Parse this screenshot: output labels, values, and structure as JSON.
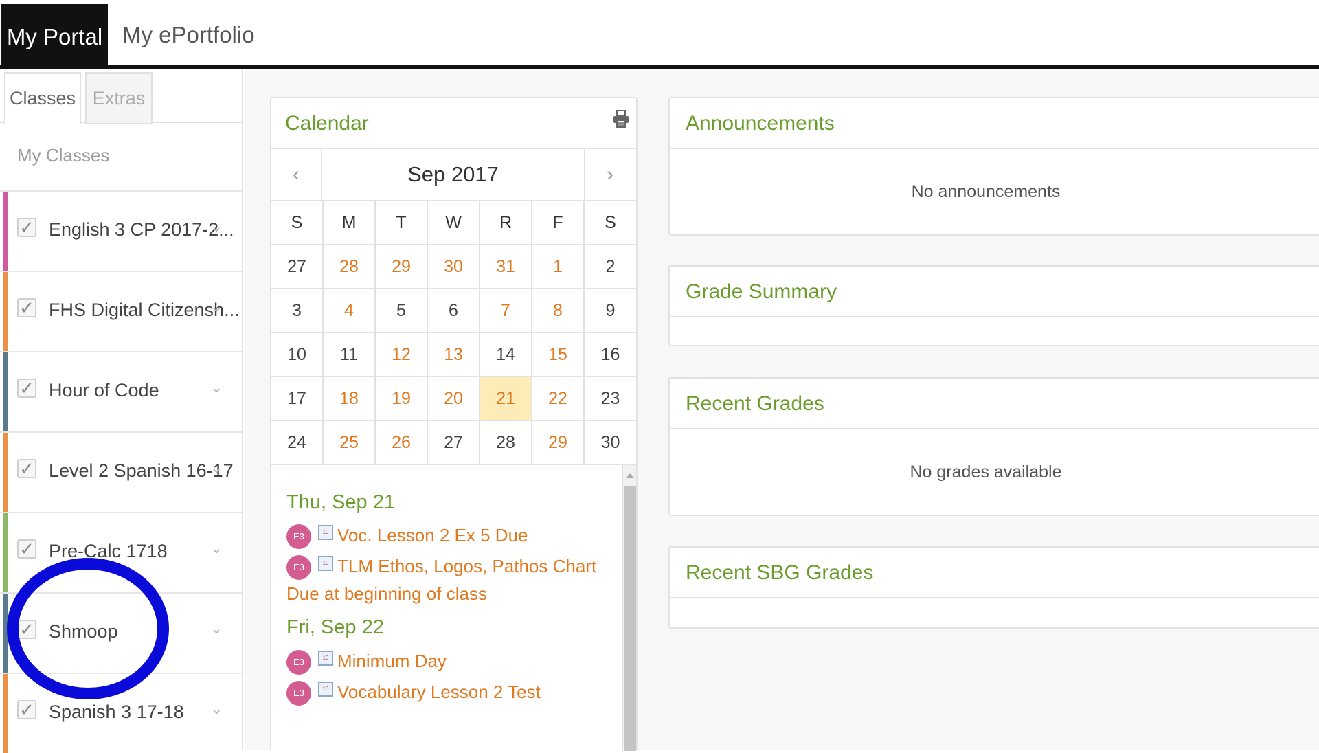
{
  "topnav": {
    "portal_tab": "My Portal",
    "eportfolio_tab": "My ePortfolio"
  },
  "sidebar": {
    "tabs": {
      "classes": "Classes",
      "extras": "Extras"
    },
    "heading": "My Classes",
    "classes": [
      {
        "name": "English 3 CP 2017-2...",
        "color": "#cf5c9c",
        "checked": true
      },
      {
        "name": "FHS Digital Citizensh...",
        "color": "#ec8f47",
        "checked": true
      },
      {
        "name": "Hour of Code",
        "color": "#5a7b8f",
        "checked": true
      },
      {
        "name": "Level 2 Spanish 16-17",
        "color": "#ec8f47",
        "checked": true
      },
      {
        "name": "Pre-Calc 1718",
        "color": "#8cb86a",
        "checked": true
      },
      {
        "name": "Shmoop",
        "color": "#5a7b8f",
        "checked": true
      },
      {
        "name": "Spanish 3 17-18",
        "color": "#ec8f47",
        "checked": true
      }
    ]
  },
  "calendar": {
    "title": "Calendar",
    "month_label": "Sep 2017",
    "prev": "‹",
    "next": "›",
    "weekdays": [
      "S",
      "M",
      "T",
      "W",
      "R",
      "F",
      "S"
    ],
    "weeks": [
      [
        {
          "d": "27",
          "ev": false
        },
        {
          "d": "28",
          "ev": true
        },
        {
          "d": "29",
          "ev": true
        },
        {
          "d": "30",
          "ev": true
        },
        {
          "d": "31",
          "ev": true
        },
        {
          "d": "1",
          "ev": true
        },
        {
          "d": "2",
          "ev": false
        }
      ],
      [
        {
          "d": "3",
          "ev": false
        },
        {
          "d": "4",
          "ev": true
        },
        {
          "d": "5",
          "ev": false
        },
        {
          "d": "6",
          "ev": false
        },
        {
          "d": "7",
          "ev": true
        },
        {
          "d": "8",
          "ev": true
        },
        {
          "d": "9",
          "ev": false
        }
      ],
      [
        {
          "d": "10",
          "ev": false
        },
        {
          "d": "11",
          "ev": false
        },
        {
          "d": "12",
          "ev": true
        },
        {
          "d": "13",
          "ev": true
        },
        {
          "d": "14",
          "ev": false
        },
        {
          "d": "15",
          "ev": true
        },
        {
          "d": "16",
          "ev": false
        }
      ],
      [
        {
          "d": "17",
          "ev": false
        },
        {
          "d": "18",
          "ev": true
        },
        {
          "d": "19",
          "ev": true
        },
        {
          "d": "20",
          "ev": true
        },
        {
          "d": "21",
          "ev": true,
          "today": true
        },
        {
          "d": "22",
          "ev": true
        },
        {
          "d": "23",
          "ev": false
        }
      ],
      [
        {
          "d": "24",
          "ev": false
        },
        {
          "d": "25",
          "ev": true
        },
        {
          "d": "26",
          "ev": true
        },
        {
          "d": "27",
          "ev": false
        },
        {
          "d": "28",
          "ev": false
        },
        {
          "d": "29",
          "ev": true
        },
        {
          "d": "30",
          "ev": false
        }
      ]
    ],
    "events": [
      {
        "day": "Thu, Sep 21",
        "items": [
          {
            "badge": "E3",
            "text": "Voc. Lesson 2 Ex 5 Due"
          },
          {
            "badge": "E3",
            "text": "TLM Ethos, Logos, Pathos Chart Due at beginning of class"
          }
        ]
      },
      {
        "day": "Fri, Sep 22",
        "items": [
          {
            "badge": "E3",
            "text": "Minimum Day"
          },
          {
            "badge": "E3",
            "text": "Vocabulary Lesson 2 Test"
          }
        ]
      }
    ],
    "icon_badge": "10"
  },
  "panels": {
    "announcements": {
      "title": "Announcements",
      "body": "No announcements"
    },
    "grade_summary": {
      "title": "Grade Summary"
    },
    "recent_grades": {
      "title": "Recent Grades",
      "body": "No grades available"
    },
    "recent_sbg": {
      "title": "Recent SBG Grades"
    }
  },
  "colors": {
    "accent_green": "#6a9d2b",
    "event_orange": "#e07a21",
    "today_highlight": "#fdebb8",
    "annotation_blue": "#0b0bd9"
  }
}
